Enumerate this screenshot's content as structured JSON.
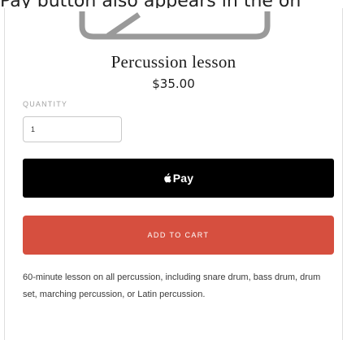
{
  "caption": {
    "text": "Pay button also appears in the on"
  },
  "product": {
    "image_icon": "product-image-placeholder",
    "title": "Percussion lesson",
    "price": "$35.00",
    "quantity_label": "QUANTITY",
    "quantity_value": "1",
    "description": "60-minute lesson on all percussion, including snare drum, bass drum, drum set, marching percussion, or Latin percussion."
  },
  "buttons": {
    "apple_pay_icon": "apple-icon",
    "apple_pay_label": "Pay",
    "add_to_cart_label": "ADD TO CART"
  },
  "colors": {
    "apple_pay_bg": "#000000",
    "add_to_cart_bg": "#d64f3f",
    "text": "#1c1c1c",
    "muted": "#a3a3a3"
  }
}
